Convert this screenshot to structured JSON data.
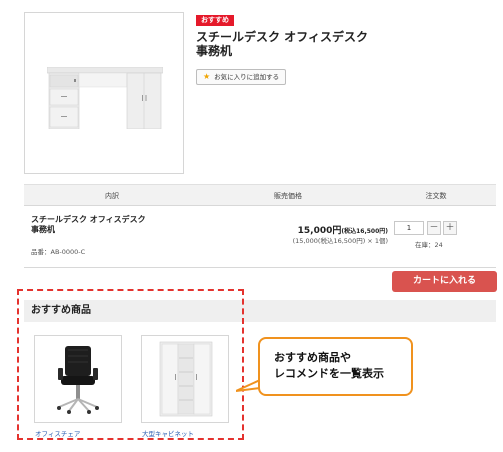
{
  "product": {
    "badge": "おすすめ",
    "title_line1": "スチールデスク オフィスデスク",
    "title_line2": "事務机",
    "favorite_label": "お気に入りに追加する"
  },
  "order_table": {
    "headers": [
      "内訳",
      "販売価格",
      "注文数"
    ],
    "item": {
      "name_line1": "スチールデスク オフィスデスク",
      "name_line2": "事務机",
      "code": "品番：AB-0000-C",
      "price": "15,000円",
      "price_tax": "(税込16,500円)",
      "price_detail": "(15,000(税込16,500円) × 1個)",
      "quantity": "1",
      "minus": "－",
      "plus": "＋",
      "stock": "在庫：24"
    }
  },
  "cart_button": "カートに入れる",
  "recommend": {
    "title": "おすすめ商品",
    "items": [
      {
        "label": "オフィスチェア"
      },
      {
        "label": "大型キャビネット"
      }
    ]
  },
  "callout": {
    "line1": "おすすめ商品や",
    "line2": "レコメンドを一覧表示"
  },
  "colors": {
    "badge": "#e5192a",
    "cart_button": "#d9534f",
    "dashed_border": "#e4322e",
    "callout_border": "#f0921e",
    "link": "#2a5db0"
  }
}
